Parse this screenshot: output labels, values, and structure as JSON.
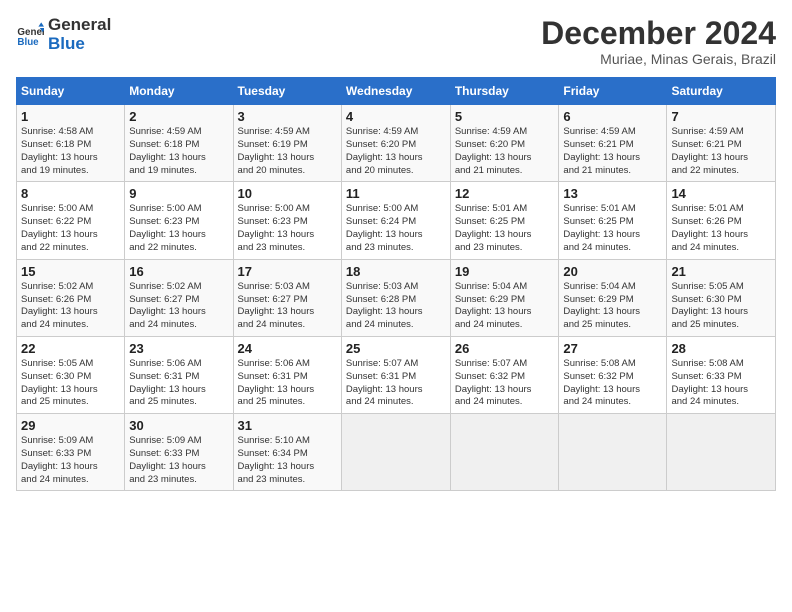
{
  "logo": {
    "line1": "General",
    "line2": "Blue"
  },
  "title": "December 2024",
  "subtitle": "Muriae, Minas Gerais, Brazil",
  "days_of_week": [
    "Sunday",
    "Monday",
    "Tuesday",
    "Wednesday",
    "Thursday",
    "Friday",
    "Saturday"
  ],
  "weeks": [
    [
      {
        "day": "1",
        "info": "Sunrise: 4:58 AM\nSunset: 6:18 PM\nDaylight: 13 hours\nand 19 minutes."
      },
      {
        "day": "2",
        "info": "Sunrise: 4:59 AM\nSunset: 6:18 PM\nDaylight: 13 hours\nand 19 minutes."
      },
      {
        "day": "3",
        "info": "Sunrise: 4:59 AM\nSunset: 6:19 PM\nDaylight: 13 hours\nand 20 minutes."
      },
      {
        "day": "4",
        "info": "Sunrise: 4:59 AM\nSunset: 6:20 PM\nDaylight: 13 hours\nand 20 minutes."
      },
      {
        "day": "5",
        "info": "Sunrise: 4:59 AM\nSunset: 6:20 PM\nDaylight: 13 hours\nand 21 minutes."
      },
      {
        "day": "6",
        "info": "Sunrise: 4:59 AM\nSunset: 6:21 PM\nDaylight: 13 hours\nand 21 minutes."
      },
      {
        "day": "7",
        "info": "Sunrise: 4:59 AM\nSunset: 6:21 PM\nDaylight: 13 hours\nand 22 minutes."
      }
    ],
    [
      {
        "day": "8",
        "info": "Sunrise: 5:00 AM\nSunset: 6:22 PM\nDaylight: 13 hours\nand 22 minutes."
      },
      {
        "day": "9",
        "info": "Sunrise: 5:00 AM\nSunset: 6:23 PM\nDaylight: 13 hours\nand 22 minutes."
      },
      {
        "day": "10",
        "info": "Sunrise: 5:00 AM\nSunset: 6:23 PM\nDaylight: 13 hours\nand 23 minutes."
      },
      {
        "day": "11",
        "info": "Sunrise: 5:00 AM\nSunset: 6:24 PM\nDaylight: 13 hours\nand 23 minutes."
      },
      {
        "day": "12",
        "info": "Sunrise: 5:01 AM\nSunset: 6:25 PM\nDaylight: 13 hours\nand 23 minutes."
      },
      {
        "day": "13",
        "info": "Sunrise: 5:01 AM\nSunset: 6:25 PM\nDaylight: 13 hours\nand 24 minutes."
      },
      {
        "day": "14",
        "info": "Sunrise: 5:01 AM\nSunset: 6:26 PM\nDaylight: 13 hours\nand 24 minutes."
      }
    ],
    [
      {
        "day": "15",
        "info": "Sunrise: 5:02 AM\nSunset: 6:26 PM\nDaylight: 13 hours\nand 24 minutes."
      },
      {
        "day": "16",
        "info": "Sunrise: 5:02 AM\nSunset: 6:27 PM\nDaylight: 13 hours\nand 24 minutes."
      },
      {
        "day": "17",
        "info": "Sunrise: 5:03 AM\nSunset: 6:27 PM\nDaylight: 13 hours\nand 24 minutes."
      },
      {
        "day": "18",
        "info": "Sunrise: 5:03 AM\nSunset: 6:28 PM\nDaylight: 13 hours\nand 24 minutes."
      },
      {
        "day": "19",
        "info": "Sunrise: 5:04 AM\nSunset: 6:29 PM\nDaylight: 13 hours\nand 24 minutes."
      },
      {
        "day": "20",
        "info": "Sunrise: 5:04 AM\nSunset: 6:29 PM\nDaylight: 13 hours\nand 25 minutes."
      },
      {
        "day": "21",
        "info": "Sunrise: 5:05 AM\nSunset: 6:30 PM\nDaylight: 13 hours\nand 25 minutes."
      }
    ],
    [
      {
        "day": "22",
        "info": "Sunrise: 5:05 AM\nSunset: 6:30 PM\nDaylight: 13 hours\nand 25 minutes."
      },
      {
        "day": "23",
        "info": "Sunrise: 5:06 AM\nSunset: 6:31 PM\nDaylight: 13 hours\nand 25 minutes."
      },
      {
        "day": "24",
        "info": "Sunrise: 5:06 AM\nSunset: 6:31 PM\nDaylight: 13 hours\nand 25 minutes."
      },
      {
        "day": "25",
        "info": "Sunrise: 5:07 AM\nSunset: 6:31 PM\nDaylight: 13 hours\nand 24 minutes."
      },
      {
        "day": "26",
        "info": "Sunrise: 5:07 AM\nSunset: 6:32 PM\nDaylight: 13 hours\nand 24 minutes."
      },
      {
        "day": "27",
        "info": "Sunrise: 5:08 AM\nSunset: 6:32 PM\nDaylight: 13 hours\nand 24 minutes."
      },
      {
        "day": "28",
        "info": "Sunrise: 5:08 AM\nSunset: 6:33 PM\nDaylight: 13 hours\nand 24 minutes."
      }
    ],
    [
      {
        "day": "29",
        "info": "Sunrise: 5:09 AM\nSunset: 6:33 PM\nDaylight: 13 hours\nand 24 minutes."
      },
      {
        "day": "30",
        "info": "Sunrise: 5:09 AM\nSunset: 6:33 PM\nDaylight: 13 hours\nand 23 minutes."
      },
      {
        "day": "31",
        "info": "Sunrise: 5:10 AM\nSunset: 6:34 PM\nDaylight: 13 hours\nand 23 minutes."
      },
      {
        "day": "",
        "info": ""
      },
      {
        "day": "",
        "info": ""
      },
      {
        "day": "",
        "info": ""
      },
      {
        "day": "",
        "info": ""
      }
    ]
  ]
}
